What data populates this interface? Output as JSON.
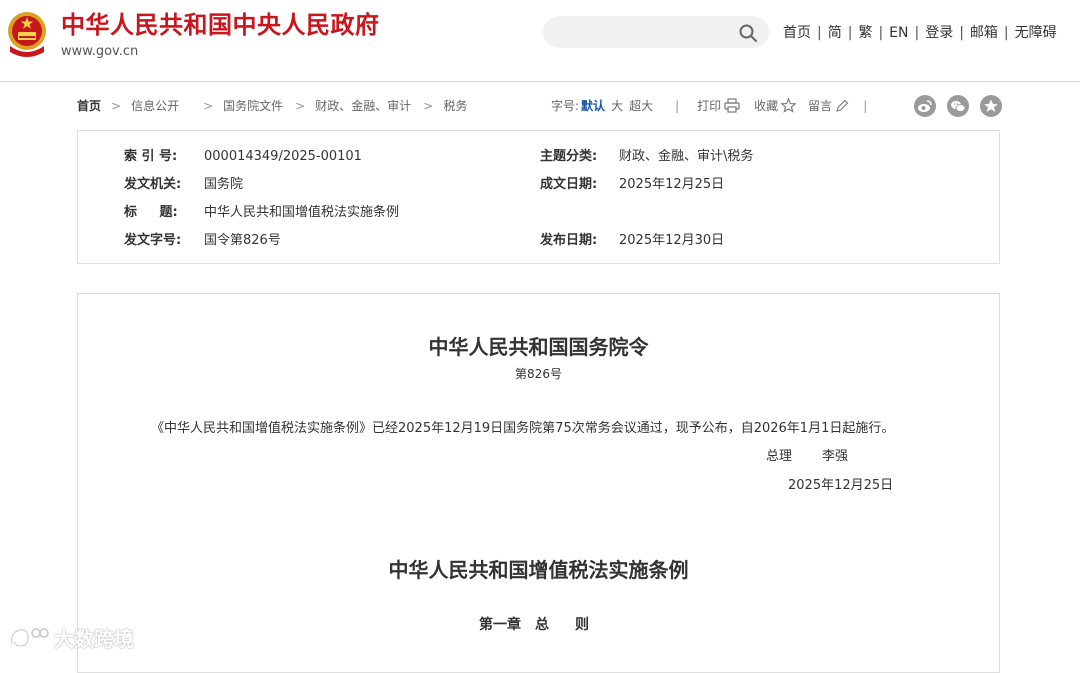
{
  "header": {
    "site_title": "中华人民共和国中央人民政府",
    "site_domain": "www.gov.cn",
    "search_placeholder": "",
    "nav": [
      "首页",
      "简",
      "繁",
      "EN",
      "登录",
      "邮箱",
      "无障碍"
    ],
    "brand_color": "#c8161d"
  },
  "breadcrumb": [
    "首页",
    "信息公开",
    "国务院文件",
    "财政、金融、审计",
    "税务"
  ],
  "toolbar": {
    "font_size_label": "字号:",
    "font_size_options": [
      "默认",
      "大",
      "超大"
    ],
    "selected_font_size": "默认",
    "print_label": "打印",
    "favorite_label": "收藏",
    "comment_label": "留言",
    "share_icons": [
      "weibo-icon",
      "wechat-icon",
      "star-icon"
    ]
  },
  "info": {
    "index_label": "索 引 号:",
    "index_value": "000014349/2025-00101",
    "category_label": "主题分类:",
    "category_value": "财政、金融、审计\\税务",
    "issuer_label": "发文机关:",
    "issuer_value": "国务院",
    "written_date_label": "成文日期:",
    "written_date_value": "2025年12月25日",
    "title_label": "标 题:",
    "title_value": "中华人民共和国增值税法实施条例",
    "doc_number_label": "发文字号:",
    "doc_number_value": "国令第826号",
    "publish_date_label": "发布日期:",
    "publish_date_value": "2025年12月30日"
  },
  "article": {
    "order_title": "中华人民共和国国务院令",
    "order_number": "第826号",
    "promulgation": "《中华人民共和国增值税法实施条例》已经2025年12月19日国务院第75次常务会议通过，现予公布，自2026年1月1日起施行。",
    "premier_title": "总理",
    "premier_name": "李强",
    "sign_date": "2025年12月25日",
    "regulation_title": "中华人民共和国增值税法实施条例",
    "chapter": [
      "第一章",
      "总",
      "则"
    ]
  },
  "watermark": {
    "text": "大数跨境"
  }
}
